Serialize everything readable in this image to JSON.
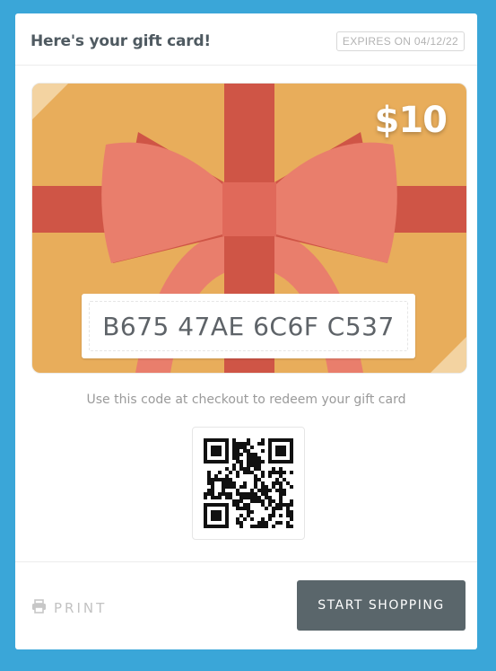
{
  "header": {
    "title": "Here's your gift card!",
    "expires": "EXPIRES ON 04/12/22"
  },
  "card": {
    "amount": "$10",
    "code": "B675 47AE 6C6F C537",
    "colors": {
      "background": "#e8ad5b",
      "ribbon": "#cf5546",
      "bow": "#e97e6c"
    }
  },
  "instruction": "Use this code at checkout to redeem your gift card",
  "footer": {
    "print_label": "PRINT",
    "shop_label": "START SHOPPING"
  },
  "icons": {
    "print": "printer-icon",
    "qr": "qr-code"
  }
}
